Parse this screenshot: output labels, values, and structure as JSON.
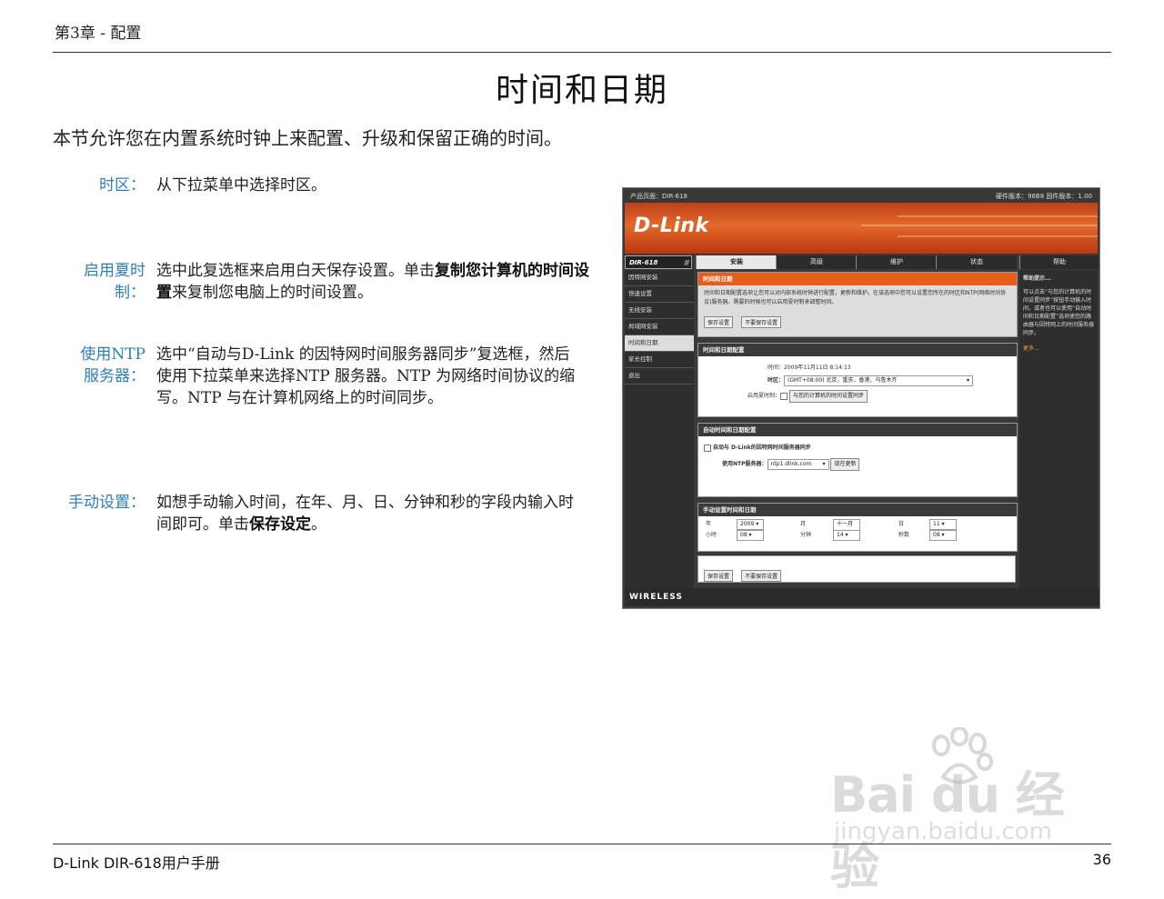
{
  "header": {
    "chapter": "第3章 - 配置"
  },
  "title": "时间和日期",
  "intro": "本节允许您在内置系统时钟上来配置、升级和保留正确的时间。",
  "sections": [
    {
      "term": "时区：",
      "desc_plain": "从下拉菜单中选择时区。"
    },
    {
      "term_l1": "启用夏时",
      "term_l2": "制：",
      "desc_a": "选中此复选框来启用白天保存设置。单击",
      "desc_b": "复制您计算机的时间设置",
      "desc_c": "来复制您电脑上的时间设置。"
    },
    {
      "term_l1": "使用NTP",
      "term_l2": "服务器：",
      "desc_plain": "选中“自动与D-Link 的因特网时间服务器同步”复选框，然后使用下拉菜单来选择NTP 服务器。NTP 为网络时间协议的缩写。NTP 与在计算机网络上的时间同步。"
    },
    {
      "term": "手动设置：",
      "desc_a": "如想手动输入时间，在年、月、日、分钟和秒的字段内输入时间即可。单击",
      "desc_b": "保存设定",
      "desc_c": "。"
    }
  ],
  "screenshot": {
    "product_page": "产品页面：DIR-618",
    "hw_fw": "硬件版本：96B8   固件版本：1.00",
    "logo": "D-Link",
    "model": "DIR-618",
    "model_slashes": "///",
    "tabs": [
      "安装",
      "高级",
      "维护",
      "状态",
      "帮助"
    ],
    "nav": [
      "因特网安装",
      "快速设置",
      "无线安装",
      "局域网安装",
      "时间和日期",
      "家长控制",
      "退出"
    ],
    "intro_panel": {
      "title": "时间和日期",
      "text": "时间和日期配置选项让您可以对内部系统时钟进行配置，更新和维护。在该选项中您可以设置您所在的时区和NTP(网络时间协议)服务器。需要的时候也可以启用夏时制来调整时间。",
      "save": "保存设置",
      "nosave": "不要保存设置"
    },
    "config_panel": {
      "title": "时间和日期配置",
      "time_label": "时间：",
      "time_value": "2009年11月11日 8:14:13",
      "tz_label": "时区：",
      "tz_value": "(GMT+08:00) 北京，重庆，香港，乌鲁木齐",
      "dst_label": "启用夏时制：",
      "copy_btn": "与您的计算机的时间设置同步"
    },
    "ntp_panel": {
      "title": "自动时间和日期配置",
      "auto_label": "自动与 D-Link的因特网时间服务器同步",
      "server_label": "使用NTP服务器：",
      "server_value": "ntp1.dlink.com",
      "update_btn": "现在更新"
    },
    "manual_panel": {
      "title": "手动设置时间和日期",
      "year_label": "年",
      "year_value": "2009",
      "month_label": "月",
      "month_value": "十一月",
      "day_label": "日",
      "day_value": "11",
      "hour_label": "小时",
      "hour_value": "08",
      "minute_label": "分钟",
      "minute_value": "14",
      "second_label": "秒数",
      "second_value": "08"
    },
    "bottom_save": "保存设置",
    "bottom_nosave": "不要保存设置",
    "help": {
      "title": "帮助提示...",
      "text": "可以点击“与您的计算机的时间设置同步”按钮手动输入时间，或者也可以使用“自动时间和日期配置”选项使您的路由器与因特网上的时间服务器同步。",
      "more": "更多..."
    },
    "wireless": "WIRELESS"
  },
  "footer": {
    "manual": "D-Link DIR-618用户手册",
    "page": "36"
  },
  "watermark": {
    "brand": "Bai du 经验",
    "url": "jingyan.baidu.com"
  }
}
